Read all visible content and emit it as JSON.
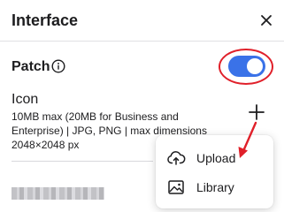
{
  "header": {
    "title": "Interface",
    "close_icon": "close-icon"
  },
  "patch": {
    "label": "Patch",
    "info_icon": "info-icon",
    "toggle_on": true,
    "toggle_color": "#3a72e8"
  },
  "icon_section": {
    "label": "Icon",
    "description": "10MB max (20MB for Business and Enterprise) | JPG, PNG | max dimensions 2048×2048 px",
    "add_icon": "plus-icon"
  },
  "menu": {
    "items": [
      {
        "label": "Upload",
        "icon": "cloud-upload-icon"
      },
      {
        "label": "Library",
        "icon": "image-library-icon"
      }
    ]
  },
  "annotations": {
    "highlight_color": "#e0202a"
  }
}
